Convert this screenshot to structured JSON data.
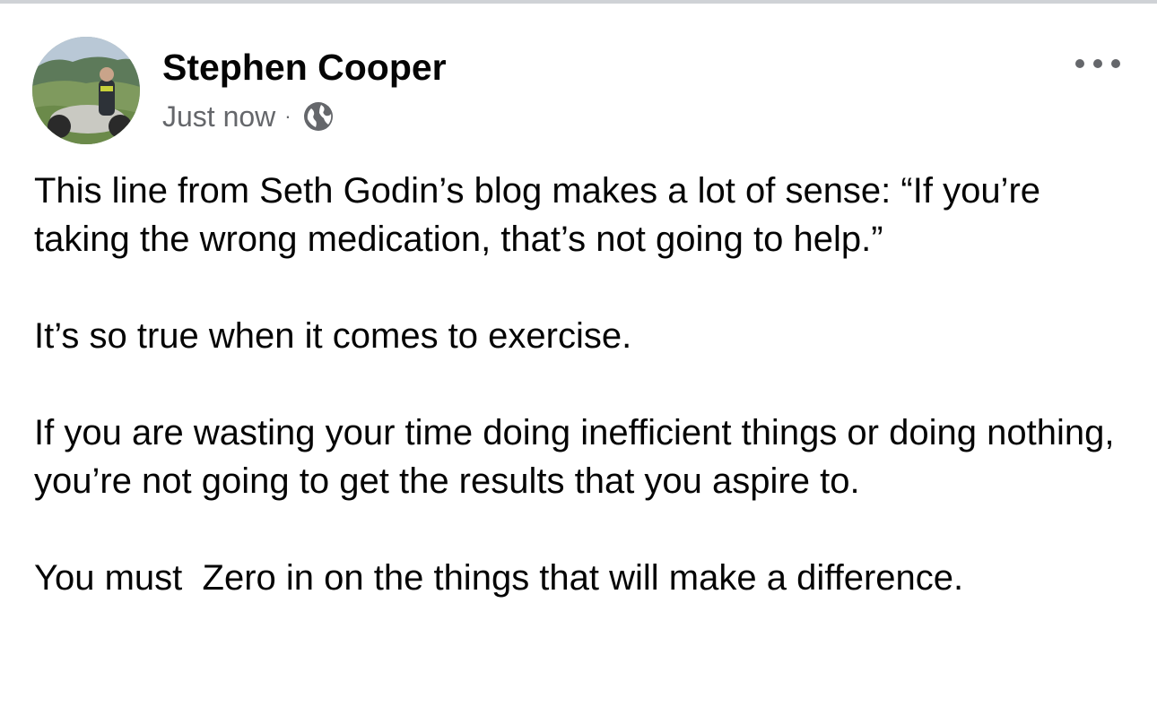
{
  "post": {
    "author": "Stephen Cooper",
    "timestamp": "Just now",
    "separator": "·",
    "audience_icon": "globe-icon",
    "more_icon": "more-options-icon",
    "paragraphs": [
      "This line from Seth Godin’s blog makes a lot of sense: “If you’re taking the wrong medication, that’s not going to help.”",
      "It’s so true when it comes to exercise.",
      "If you are wasting your time doing inefficient things or doing nothing, you’re not going to get the results that you aspire to.",
      "You must  Zero in on the things that will make a difference."
    ]
  },
  "colors": {
    "text_primary": "#050505",
    "text_secondary": "#65676b",
    "divider": "#cfd2d6"
  }
}
